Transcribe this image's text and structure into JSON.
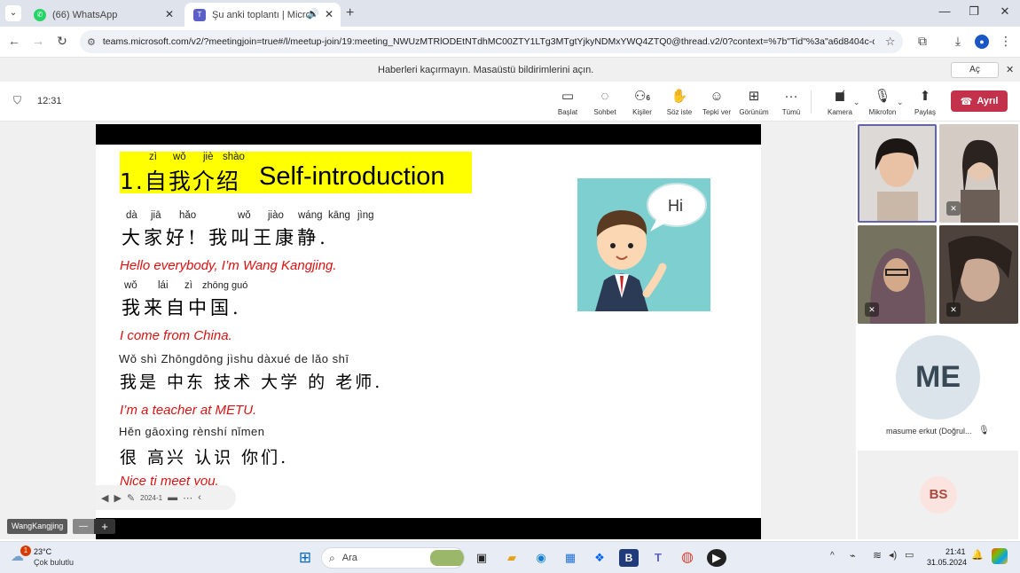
{
  "browser": {
    "tabs": [
      {
        "title": "(66) WhatsApp",
        "icon": "whatsapp-icon"
      },
      {
        "title": "Şu anki toplantı | Microsoft",
        "icon": "teams-icon"
      }
    ],
    "url": "teams.microsoft.com/v2/?meetingjoin=true#/l/meetup-join/19:meeting_NWUzMTRlODEtNTdhMC00ZTY1LTg3MTgtYjkyNDMxYWQ4ZTQ0@thread.v2/0?context=%7b\"Tid\"%3a\"a6d8404c-c..."
  },
  "notification": {
    "text": "Haberleri kaçırmayın. Masaüstü bildirimlerini açın.",
    "action": "Aç"
  },
  "meeting": {
    "time": "12:31",
    "toolbar": {
      "share_screen": "Başlat",
      "chat": "Sohbet",
      "people": "Kişiler",
      "people_count": "6",
      "raise_hand": "Söz iste",
      "react": "Tepki ver",
      "view": "Görünüm",
      "more": "Tümü",
      "camera": "Kamera",
      "mic": "Mikrofon",
      "share": "Paylaş",
      "leave": "Ayrıl"
    },
    "presenter_name": "WangKangjing",
    "participant_name": "masume erkut (Doğrul...",
    "participant_initials": "ME",
    "bs_initials": "BS"
  },
  "slide": {
    "title_pinyin": [
      "zì",
      "wǒ",
      "jiè",
      "shào"
    ],
    "title_zh": "1.自我介绍",
    "title_en": "Self-introduction",
    "line1_pinyin": [
      "dà",
      "jiā",
      "hǎo",
      "wǒ",
      "jiào",
      "wáng",
      "kāng",
      "jìng"
    ],
    "line1_zh": "大家好! 我叫王康静.",
    "line1_en": "Hello everybody, I’m Wang Kangjing.",
    "line2_pinyin": [
      "wǒ",
      "lái",
      "zì",
      "zhōng guó"
    ],
    "line2_zh": "我来自中国.",
    "line2_en": "I come from China.",
    "line3_pinyin": "Wǒ shì Zhōngdōng jìshu dàxué  de  lǎo shī",
    "line3_zh": "我是 中东 技术 大学 的 老师.",
    "line3_en": "I’m a teacher at METU.",
    "line4_pinyin": "Hěn gāoxìng rènshí nǐmen",
    "line4_zh": "很 高兴 认识 你们.",
    "line4_en": "Nice ti meet you.",
    "bubble": "Hi",
    "page_indicator": "2024-1"
  },
  "taskbar": {
    "weather_temp": "23°C",
    "weather_desc": "Çok bulutlu",
    "weather_badge": "1",
    "search": "Ara",
    "time": "21:41",
    "date": "31.05.2024"
  }
}
